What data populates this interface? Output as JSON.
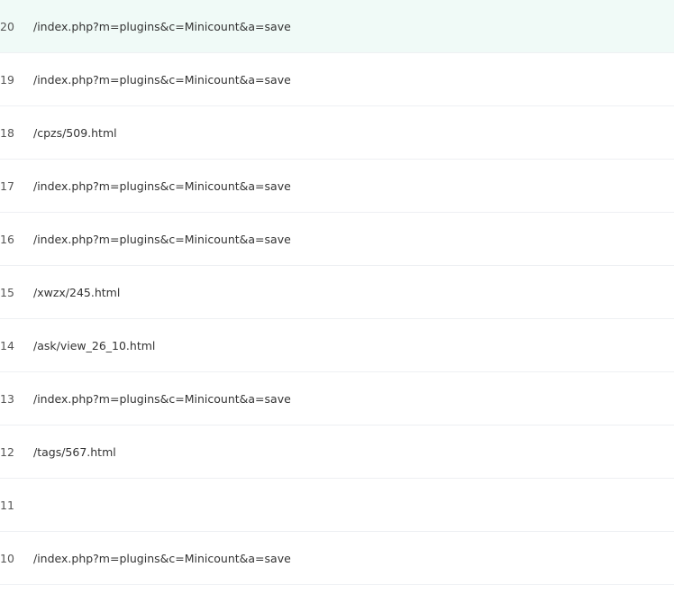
{
  "rows": [
    {
      "id": "20",
      "url": "/index.php?m=plugins&c=Minicount&a=save",
      "highlighted": true
    },
    {
      "id": "19",
      "url": "/index.php?m=plugins&c=Minicount&a=save",
      "highlighted": false
    },
    {
      "id": "18",
      "url": "/cpzs/509.html",
      "highlighted": false
    },
    {
      "id": "17",
      "url": "/index.php?m=plugins&c=Minicount&a=save",
      "highlighted": false
    },
    {
      "id": "16",
      "url": "/index.php?m=plugins&c=Minicount&a=save",
      "highlighted": false
    },
    {
      "id": "15",
      "url": "/xwzx/245.html",
      "highlighted": false
    },
    {
      "id": "14",
      "url": "/ask/view_26_10.html",
      "highlighted": false
    },
    {
      "id": "13",
      "url": "/index.php?m=plugins&c=Minicount&a=save",
      "highlighted": false
    },
    {
      "id": "12",
      "url": "/tags/567.html",
      "highlighted": false
    },
    {
      "id": "11",
      "url": "",
      "highlighted": false
    },
    {
      "id": "10",
      "url": "/index.php?m=plugins&c=Minicount&a=save",
      "highlighted": false
    }
  ]
}
